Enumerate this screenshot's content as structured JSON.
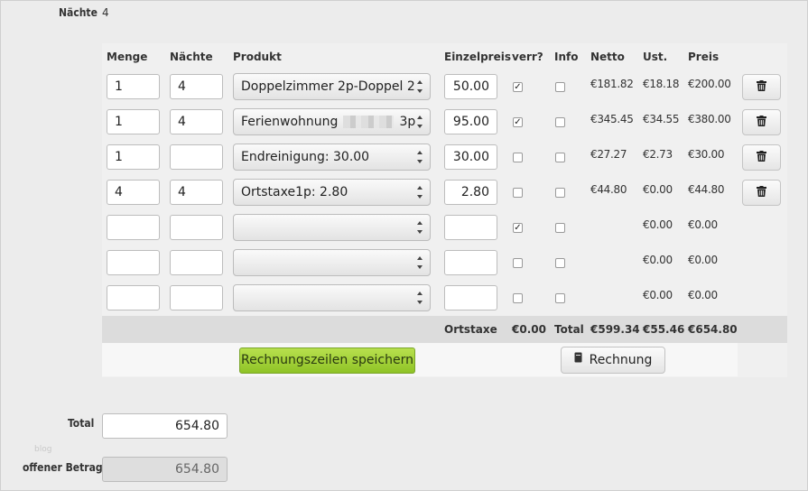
{
  "top": {
    "label": "Nächte",
    "value": "4"
  },
  "headers": [
    "Menge",
    "Nächte",
    "Produkt",
    "Einzelpreis",
    "verr?",
    "Info",
    "Netto",
    "Ust.",
    "Preis"
  ],
  "rows": [
    {
      "menge": "1",
      "naechte": "4",
      "produkt": "Doppelzimmer 2p-Doppel 2",
      "einzelpreis": "50.00",
      "verr": true,
      "info": false,
      "netto": "€181.82",
      "ust": "€18.18",
      "preis": "€200.00",
      "delete": true
    },
    {
      "menge": "1",
      "naechte": "4",
      "produkt": "Ferienwohnung",
      "produkt_suffix": "3p",
      "einzelpreis": "95.00",
      "verr": true,
      "info": false,
      "netto": "€345.45",
      "ust": "€34.55",
      "preis": "€380.00",
      "delete": true
    },
    {
      "menge": "1",
      "naechte": "",
      "produkt": "Endreinigung: 30.00",
      "einzelpreis": "30.00",
      "verr": false,
      "info": false,
      "netto": "€27.27",
      "ust": "€2.73",
      "preis": "€30.00",
      "delete": true
    },
    {
      "menge": "4",
      "naechte": "4",
      "produkt": "Ortstaxe1p: 2.80",
      "einzelpreis": "2.80",
      "verr": false,
      "info": false,
      "netto": "€44.80",
      "ust": "€0.00",
      "preis": "€44.80",
      "delete": true
    },
    {
      "menge": "",
      "naechte": "",
      "produkt": "",
      "einzelpreis": "",
      "verr": true,
      "info": false,
      "netto": "",
      "ust": "€0.00",
      "preis": "€0.00",
      "delete": false
    },
    {
      "menge": "",
      "naechte": "",
      "produkt": "",
      "einzelpreis": "",
      "verr": false,
      "info": false,
      "netto": "",
      "ust": "€0.00",
      "preis": "€0.00",
      "delete": false
    },
    {
      "menge": "",
      "naechte": "",
      "produkt": "",
      "einzelpreis": "",
      "verr": false,
      "info": false,
      "netto": "",
      "ust": "€0.00",
      "preis": "€0.00",
      "delete": false
    }
  ],
  "summary": {
    "ortstaxe_label": "Ortstaxe",
    "ortstaxe_value": "€0.00",
    "total_label": "Total",
    "netto": "€599.34",
    "ust": "€55.46",
    "preis": "€654.80"
  },
  "buttons": {
    "save": "Rechnungszeilen speichern",
    "invoice": "Rechnung"
  },
  "footer": {
    "total_label": "Total",
    "total_value": "654.80",
    "offen_label": "offener Betrag",
    "offen_value": "654.80",
    "watermark": "blog"
  },
  "icons": {
    "delete": "trash-icon",
    "invoice": "document-icon",
    "check": "checkmark-icon"
  }
}
